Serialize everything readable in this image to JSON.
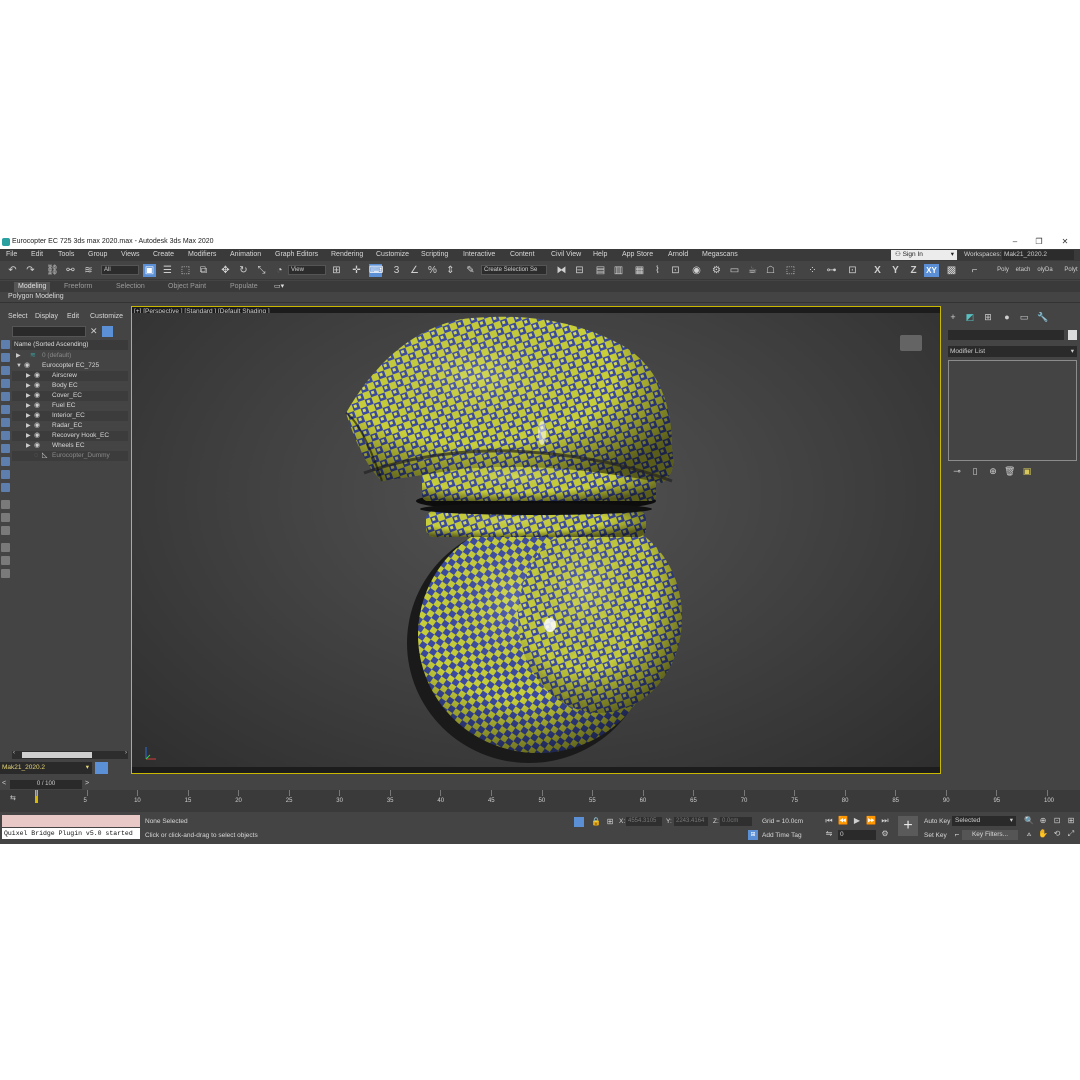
{
  "window": {
    "title": "Eurocopter EC 725 3ds max 2020.max - Autodesk 3ds Max 2020",
    "minimize": "‒",
    "maximize": "❐",
    "close": "✕"
  },
  "menu": [
    "File",
    "Edit",
    "Tools",
    "Group",
    "Views",
    "Create",
    "Modifiers",
    "Animation",
    "Graph Editors",
    "Rendering",
    "Customize",
    "Scripting",
    "Interactive",
    "Content",
    "Civil View",
    "Help",
    "App Store",
    "Arnold",
    "Megascans"
  ],
  "account": {
    "sign_in": "Sign In",
    "workspaces_label": "Workspaces:",
    "workspace": "Mak21_2020.2"
  },
  "toolbar": {
    "filter": "All",
    "reference_coord": "View",
    "selection_set": "Create Selection Se",
    "axis_x": "X",
    "axis_y": "Y",
    "axis_z": "Z",
    "axis_xy": "XY",
    "right_tabs": [
      "Poly",
      "etach",
      "olyDa",
      "Polyt"
    ]
  },
  "ribbon": {
    "tabs": [
      "Modeling",
      "Freeform",
      "Selection",
      "Object Paint",
      "Populate"
    ],
    "active_tab": "Modeling",
    "subpanel": "Polygon Modeling"
  },
  "scene_explorer": {
    "tabs": [
      "Select",
      "Display",
      "Edit",
      "Customize"
    ],
    "column_header": "Name (Sorted Ascending)",
    "items": [
      {
        "label": "0 (default)",
        "type": "layer"
      },
      {
        "label": "Eurocopter EC_725",
        "type": "layer"
      },
      {
        "label": "Airscrew"
      },
      {
        "label": "Body EC"
      },
      {
        "label": "Cover_EC"
      },
      {
        "label": "Fuel EC"
      },
      {
        "label": "Interior_EC"
      },
      {
        "label": "Radar_EC"
      },
      {
        "label": "Recovery Hook_EC"
      },
      {
        "label": "Wheels EC"
      },
      {
        "label": "Eurocopter_Dummy"
      }
    ],
    "layer_dropdown": "Mak21_2020.2"
  },
  "viewport": {
    "label": "[+] [Perspective ] [Standard ] [Default Shading ]",
    "checker_colors": {
      "yellow": "#c8cf3a",
      "blue": "#3b4aa0"
    }
  },
  "command_panel": {
    "modifier_list": "Modifier List"
  },
  "timeline": {
    "range": "0 / 100",
    "prev": "<",
    "next": ">",
    "ticks": [
      "0",
      "5",
      "10",
      "15",
      "20",
      "25",
      "30",
      "35",
      "40",
      "45",
      "50",
      "55",
      "60",
      "65",
      "70",
      "75",
      "80",
      "85",
      "90",
      "95",
      "100"
    ]
  },
  "status": {
    "maxscript_output": "Quixel Bridge Plugin v5.0 started",
    "selection": "None Selected",
    "prompt": "Click or click-and-drag to select objects",
    "x_label": "X:",
    "x_value": "4554.3105",
    "y_label": "Y:",
    "y_value": "2243.4164",
    "z_label": "Z:",
    "z_value": "0.0cm",
    "grid": "Grid = 10.0cm",
    "add_time_tag": "Add Time Tag",
    "auto_key": "Auto Key",
    "set_key": "Set Key",
    "key_mode": "Selected",
    "key_filters": "Key Filters...",
    "current_frame": "0"
  }
}
